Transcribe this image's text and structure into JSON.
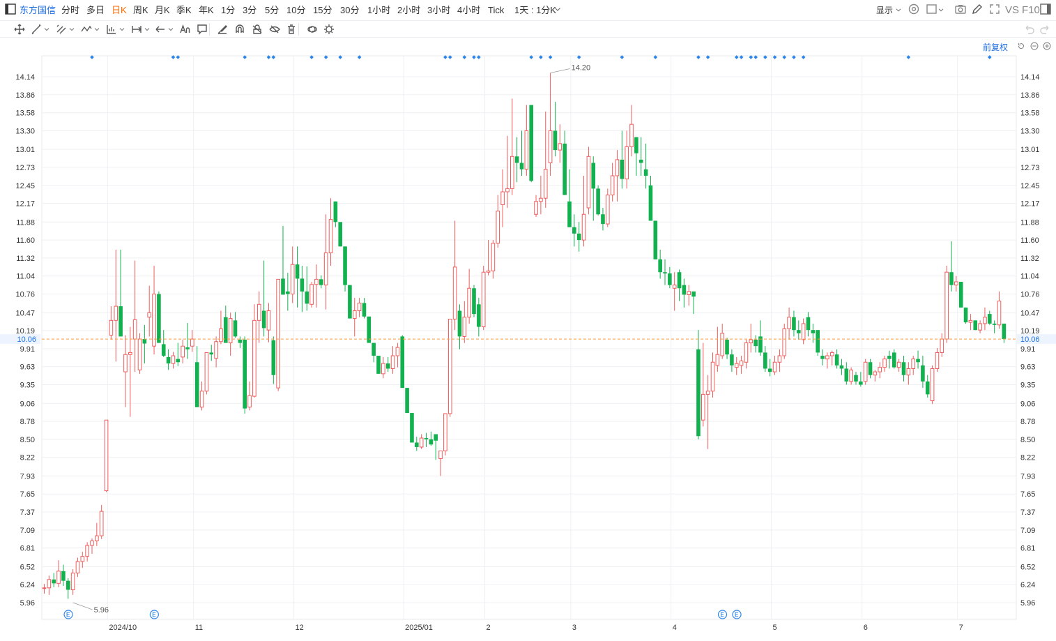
{
  "app": {
    "brand": "东方国信"
  },
  "periods": [
    {
      "label": "分时",
      "active": false
    },
    {
      "label": "多日",
      "active": false
    },
    {
      "label": "日K",
      "active": true
    },
    {
      "label": "周K",
      "active": false
    },
    {
      "label": "月K",
      "active": false
    },
    {
      "label": "季K",
      "active": false
    },
    {
      "label": "年K",
      "active": false
    },
    {
      "label": "1分",
      "active": false
    },
    {
      "label": "3分",
      "active": false
    },
    {
      "label": "5分",
      "active": false
    },
    {
      "label": "10分",
      "active": false
    },
    {
      "label": "15分",
      "active": false
    },
    {
      "label": "30分",
      "active": false
    },
    {
      "label": "1小时",
      "active": false
    },
    {
      "label": "2小时",
      "active": false
    },
    {
      "label": "3小时",
      "active": false
    },
    {
      "label": "4小时",
      "active": false
    },
    {
      "label": "Tick",
      "active": false
    }
  ],
  "custom_period": "1天 : 1分K",
  "right_controls": {
    "display_label": "显示",
    "vs_label": "VS",
    "f10_label": "F10"
  },
  "adjust_label": "前复权",
  "colors": {
    "up": "#f05b5b",
    "down": "#10b14e",
    "accent": "#1f6fe0",
    "active": "#ff6a00",
    "price_line": "#ff9a3c",
    "event_dot": "#2f86e9"
  },
  "draw_tools": [
    "move-icon",
    "line-icon",
    "channel-icon",
    "wave-icon",
    "measure-icon",
    "range-icon",
    "arrow-icon",
    "text-icon",
    "note-icon",
    "brush-icon",
    "magnet-icon",
    "lock-icon",
    "hide-icon",
    "delete-icon",
    "link-icon",
    "settings-icon"
  ],
  "chart_data": {
    "type": "candlestick",
    "y_ticks": [
      "14.14",
      "13.86",
      "13.58",
      "13.30",
      "13.01",
      "12.73",
      "12.45",
      "12.17",
      "11.88",
      "11.60",
      "11.32",
      "11.04",
      "10.76",
      "10.47",
      "10.19",
      "9.91",
      "9.63",
      "9.35",
      "9.06",
      "8.78",
      "8.50",
      "8.22",
      "7.93",
      "7.65",
      "7.37",
      "7.09",
      "6.81",
      "6.52",
      "6.24",
      "5.96"
    ],
    "ylim": [
      5.96,
      14.14
    ],
    "x_labels": [
      {
        "label": "2024/10",
        "index": 14
      },
      {
        "label": "11",
        "index": 32
      },
      {
        "label": "12",
        "index": 53
      },
      {
        "label": "2025/01",
        "index": 76
      },
      {
        "label": "2",
        "index": 93
      },
      {
        "label": "3",
        "index": 111
      },
      {
        "label": "4",
        "index": 132
      },
      {
        "label": "5",
        "index": 153
      },
      {
        "label": "6",
        "index": 172
      },
      {
        "label": "7",
        "index": 192
      }
    ],
    "last_price": "10.06",
    "max_label": {
      "value": "14.20",
      "index": 106
    },
    "min_label": {
      "value": "5.96",
      "index": 6
    },
    "event_markers": [
      3,
      21,
      140,
      143
    ],
    "signal_dots": [
      10,
      27,
      28,
      42,
      47,
      48,
      56,
      59,
      62,
      66,
      84,
      85,
      88,
      90,
      91,
      102,
      104,
      106,
      112,
      121,
      128,
      137,
      139,
      145,
      146,
      148,
      149,
      151,
      153,
      155,
      157,
      159,
      181,
      198
    ],
    "candles": [
      [
        6.18,
        6.25,
        6.1,
        6.19
      ],
      [
        6.19,
        6.38,
        6.08,
        6.32
      ],
      [
        6.32,
        6.42,
        6.2,
        6.26
      ],
      [
        6.26,
        6.62,
        6.2,
        6.45
      ],
      [
        6.45,
        6.55,
        6.22,
        6.3
      ],
      [
        6.3,
        6.34,
        6.02,
        6.16
      ],
      [
        6.16,
        6.48,
        6.08,
        6.42
      ],
      [
        6.42,
        6.66,
        6.36,
        6.6
      ],
      [
        6.6,
        6.75,
        6.5,
        6.68
      ],
      [
        6.68,
        6.9,
        6.6,
        6.85
      ],
      [
        6.85,
        6.96,
        6.72,
        6.92
      ],
      [
        6.92,
        7.2,
        6.84,
        7.0
      ],
      [
        7.0,
        7.48,
        6.95,
        7.38
      ],
      [
        7.7,
        8.8,
        7.68,
        8.8
      ],
      [
        10.12,
        10.57,
        10.05,
        10.35
      ],
      [
        10.35,
        11.45,
        9.71,
        10.57
      ],
      [
        10.57,
        11.45,
        10.2,
        10.1
      ],
      [
        9.55,
        10.12,
        9.0,
        9.82
      ],
      [
        9.82,
        10.25,
        8.85,
        9.85
      ],
      [
        10.06,
        11.28,
        9.55,
        10.36
      ],
      [
        9.58,
        10.15,
        9.52,
        10.06
      ],
      [
        10.06,
        10.28,
        9.68,
        9.99
      ],
      [
        10.4,
        10.89,
        10.1,
        10.47
      ],
      [
        9.95,
        11.2,
        9.82,
        10.76
      ],
      [
        10.76,
        10.8,
        10.0,
        10.0
      ],
      [
        9.98,
        10.2,
        9.78,
        9.8
      ],
      [
        9.78,
        9.9,
        9.58,
        9.68
      ],
      [
        9.68,
        9.86,
        9.6,
        9.8
      ],
      [
        9.75,
        10.0,
        9.64,
        9.7
      ],
      [
        9.78,
        10.05,
        9.68,
        9.95
      ],
      [
        9.93,
        10.31,
        9.75,
        9.9
      ],
      [
        9.95,
        10.2,
        9.86,
        10.06
      ],
      [
        9.7,
        9.95,
        9.0,
        9.0
      ],
      [
        9.0,
        9.4,
        8.95,
        9.25
      ],
      [
        9.25,
        9.82,
        9.2,
        9.85
      ],
      [
        9.85,
        9.97,
        9.72,
        9.82
      ],
      [
        9.76,
        10.1,
        9.62,
        10.02
      ],
      [
        10.02,
        10.5,
        9.98,
        10.22
      ],
      [
        10.4,
        10.58,
        10.3,
        10.0
      ],
      [
        10.0,
        10.47,
        9.8,
        10.38
      ],
      [
        10.35,
        10.48,
        10.08,
        10.1
      ],
      [
        10.05,
        10.1,
        9.92,
        10.0
      ],
      [
        10.05,
        10.1,
        8.9,
        8.98
      ],
      [
        9.0,
        9.4,
        8.95,
        9.18
      ],
      [
        9.17,
        10.6,
        9.15,
        10.35
      ],
      [
        10.35,
        10.8,
        10.0,
        10.6
      ],
      [
        10.5,
        11.28,
        10.1,
        10.23
      ],
      [
        10.2,
        10.62,
        10.01,
        10.5
      ],
      [
        10.04,
        10.1,
        9.36,
        9.5
      ],
      [
        9.3,
        10.25,
        9.25,
        10.99
      ],
      [
        11.0,
        11.82,
        10.75,
        10.75
      ],
      [
        10.8,
        11.09,
        10.5,
        10.76
      ],
      [
        10.76,
        11.5,
        10.62,
        11.22
      ],
      [
        11.22,
        11.5,
        10.55,
        11.0
      ],
      [
        11.0,
        11.2,
        10.48,
        10.8
      ],
      [
        10.8,
        11.19,
        10.5,
        10.61
      ],
      [
        10.6,
        10.95,
        10.55,
        10.91
      ],
      [
        10.91,
        11.22,
        10.55,
        10.99
      ],
      [
        10.99,
        11.05,
        10.85,
        10.9
      ],
      [
        10.9,
        12.0,
        10.52,
        11.4
      ],
      [
        11.4,
        12.25,
        11.2,
        11.92
      ],
      [
        12.2,
        12.2,
        11.8,
        11.88
      ],
      [
        11.88,
        11.88,
        11.5,
        11.5
      ],
      [
        11.5,
        11.5,
        10.8,
        10.9
      ],
      [
        10.9,
        10.9,
        10.38,
        10.38
      ],
      [
        10.38,
        10.7,
        10.1,
        10.5
      ],
      [
        10.5,
        10.7,
        10.4,
        10.62
      ],
      [
        10.62,
        10.7,
        10.38,
        10.41
      ],
      [
        10.41,
        10.41,
        10.0,
        10.0
      ],
      [
        10.0,
        10.0,
        9.7,
        9.8
      ],
      [
        9.8,
        9.8,
        9.52,
        9.52
      ],
      [
        9.52,
        9.78,
        9.45,
        9.68
      ],
      [
        9.68,
        9.78,
        9.55,
        9.6
      ],
      [
        9.6,
        9.95,
        9.52,
        9.8
      ],
      [
        9.8,
        10.0,
        9.62,
        9.93
      ],
      [
        10.1,
        10.12,
        9.3,
        9.3
      ],
      [
        9.3,
        9.3,
        8.91,
        8.91
      ],
      [
        8.91,
        8.91,
        8.45,
        8.45
      ],
      [
        8.45,
        8.54,
        8.32,
        8.38
      ],
      [
        8.38,
        8.58,
        8.35,
        8.52
      ],
      [
        8.52,
        8.6,
        8.38,
        8.5
      ],
      [
        8.5,
        8.62,
        8.4,
        8.42
      ],
      [
        8.58,
        8.58,
        8.18,
        8.48
      ],
      [
        8.2,
        8.28,
        7.93,
        8.32
      ],
      [
        8.32,
        8.9,
        8.25,
        8.9
      ],
      [
        8.9,
        10.37,
        8.85,
        10.37
      ],
      [
        10.37,
        11.9,
        10.2,
        11.18
      ],
      [
        10.5,
        10.6,
        9.9,
        10.1
      ],
      [
        10.1,
        10.65,
        10.0,
        10.4
      ],
      [
        10.4,
        11.15,
        10.3,
        10.85
      ],
      [
        10.85,
        10.9,
        10.4,
        10.45
      ],
      [
        10.6,
        10.7,
        10.1,
        10.25
      ],
      [
        10.25,
        11.2,
        10.2,
        11.1
      ],
      [
        11.1,
        11.6,
        11.05,
        11.12
      ],
      [
        11.12,
        11.6,
        11.0,
        11.55
      ],
      [
        11.55,
        12.3,
        11.48,
        12.05
      ],
      [
        12.15,
        12.7,
        11.8,
        12.35
      ],
      [
        12.35,
        13.22,
        12.1,
        12.4
      ],
      [
        12.4,
        13.8,
        12.3,
        12.9
      ],
      [
        12.9,
        13.2,
        12.5,
        12.8
      ],
      [
        12.8,
        13.3,
        12.6,
        12.7
      ],
      [
        12.7,
        13.7,
        12.6,
        13.3
      ],
      [
        13.7,
        13.7,
        12.5,
        12.52
      ],
      [
        12.0,
        12.3,
        11.96,
        12.2
      ],
      [
        12.2,
        12.6,
        12.0,
        12.25
      ],
      [
        12.25,
        13.6,
        12.1,
        12.7
      ],
      [
        12.8,
        14.2,
        12.6,
        13.3
      ],
      [
        13.3,
        13.75,
        12.9,
        13.0
      ],
      [
        13.0,
        13.4,
        12.8,
        13.1
      ],
      [
        13.1,
        13.3,
        12.3,
        12.3
      ],
      [
        12.2,
        12.7,
        11.8,
        11.8
      ],
      [
        11.8,
        12.0,
        11.5,
        11.7
      ],
      [
        11.7,
        11.88,
        11.42,
        11.6
      ],
      [
        11.6,
        12.6,
        11.5,
        12.0
      ],
      [
        12.1,
        13.05,
        12.0,
        12.9
      ],
      [
        12.8,
        12.9,
        11.9,
        12.4
      ],
      [
        12.4,
        12.45,
        11.98,
        12.0
      ],
      [
        12.0,
        12.1,
        11.75,
        11.85
      ],
      [
        11.85,
        12.4,
        11.8,
        12.3
      ],
      [
        12.3,
        12.8,
        12.2,
        12.6
      ],
      [
        12.6,
        13.0,
        12.2,
        12.85
      ],
      [
        12.85,
        13.3,
        12.4,
        12.55
      ],
      [
        12.55,
        13.3,
        12.4,
        13.05
      ],
      [
        13.05,
        13.7,
        12.9,
        13.4
      ],
      [
        13.2,
        13.2,
        12.6,
        12.95
      ],
      [
        12.85,
        13.2,
        12.6,
        12.8
      ],
      [
        12.7,
        13.1,
        12.4,
        12.6
      ],
      [
        12.45,
        12.6,
        11.9,
        11.9
      ],
      [
        11.9,
        11.9,
        11.3,
        11.3
      ],
      [
        11.3,
        11.45,
        11.0,
        11.1
      ],
      [
        11.1,
        11.3,
        10.9,
        11.08
      ],
      [
        11.08,
        11.18,
        10.85,
        10.9
      ],
      [
        10.85,
        11.1,
        10.5,
        10.9
      ],
      [
        11.1,
        11.14,
        10.65,
        10.85
      ],
      [
        10.9,
        11.0,
        10.55,
        10.75
      ],
      [
        10.75,
        10.9,
        10.58,
        10.8
      ],
      [
        10.8,
        10.8,
        10.45,
        10.72
      ],
      [
        9.9,
        10.2,
        8.5,
        8.55
      ],
      [
        8.8,
        10.0,
        8.7,
        9.2
      ],
      [
        9.2,
        9.5,
        8.35,
        9.25
      ],
      [
        9.25,
        9.85,
        9.15,
        9.7
      ],
      [
        9.65,
        10.25,
        9.55,
        9.82
      ],
      [
        9.8,
        10.3,
        9.75,
        10.15
      ],
      [
        10.05,
        10.08,
        9.75,
        9.82
      ],
      [
        9.82,
        9.9,
        9.55,
        9.65
      ],
      [
        9.62,
        9.78,
        9.5,
        9.68
      ],
      [
        9.65,
        9.8,
        9.52,
        9.72
      ],
      [
        9.7,
        10.05,
        9.6,
        10.0
      ],
      [
        10.0,
        10.3,
        9.85,
        10.05
      ],
      [
        10.05,
        10.12,
        9.85,
        9.95
      ],
      [
        10.1,
        10.35,
        9.8,
        9.85
      ],
      [
        9.85,
        9.95,
        9.55,
        9.6
      ],
      [
        9.6,
        9.75,
        9.48,
        9.55
      ],
      [
        9.55,
        9.8,
        9.5,
        9.7
      ],
      [
        9.7,
        9.9,
        9.55,
        9.8
      ],
      [
        9.8,
        10.3,
        9.75,
        10.22
      ],
      [
        10.22,
        10.55,
        10.05,
        10.4
      ],
      [
        10.4,
        10.5,
        10.1,
        10.2
      ],
      [
        10.2,
        10.35,
        10.05,
        10.15
      ],
      [
        10.05,
        10.38,
        9.98,
        10.3
      ],
      [
        10.4,
        10.48,
        10.1,
        10.2
      ],
      [
        10.2,
        10.3,
        10.0,
        10.15
      ],
      [
        10.2,
        10.2,
        9.8,
        9.85
      ],
      [
        9.8,
        9.9,
        9.65,
        9.75
      ],
      [
        9.75,
        9.85,
        9.6,
        9.8
      ],
      [
        9.8,
        9.88,
        9.65,
        9.85
      ],
      [
        9.82,
        9.9,
        9.6,
        9.65
      ],
      [
        9.65,
        9.75,
        9.5,
        9.6
      ],
      [
        9.6,
        9.7,
        9.35,
        9.4
      ],
      [
        9.4,
        9.62,
        9.35,
        9.58
      ],
      [
        9.5,
        9.55,
        9.35,
        9.4
      ],
      [
        9.4,
        9.55,
        9.32,
        9.35
      ],
      [
        9.4,
        9.75,
        9.35,
        9.7
      ],
      [
        9.7,
        9.75,
        9.45,
        9.5
      ],
      [
        9.5,
        9.58,
        9.4,
        9.55
      ],
      [
        9.55,
        9.7,
        9.45,
        9.62
      ],
      [
        9.62,
        9.8,
        9.55,
        9.75
      ],
      [
        9.8,
        9.88,
        9.6,
        9.75
      ],
      [
        9.85,
        9.9,
        9.6,
        9.62
      ],
      [
        9.62,
        9.75,
        9.55,
        9.7
      ],
      [
        9.7,
        9.8,
        9.4,
        9.5
      ],
      [
        9.5,
        9.7,
        9.35,
        9.6
      ],
      [
        9.6,
        9.8,
        9.5,
        9.75
      ],
      [
        9.75,
        9.88,
        9.6,
        9.7
      ],
      [
        9.65,
        9.8,
        9.3,
        9.4
      ],
      [
        9.4,
        9.5,
        9.15,
        9.2
      ],
      [
        9.1,
        9.65,
        9.05,
        9.6
      ],
      [
        9.6,
        9.92,
        9.55,
        9.85
      ],
      [
        9.85,
        10.15,
        9.78,
        10.06
      ],
      [
        10.06,
        11.2,
        10.0,
        11.1
      ],
      [
        11.1,
        11.58,
        10.8,
        10.9
      ],
      [
        10.9,
        11.04,
        10.8,
        10.95
      ],
      [
        10.95,
        10.95,
        10.55,
        10.55
      ],
      [
        10.55,
        10.55,
        10.3,
        10.32
      ],
      [
        10.32,
        10.45,
        10.2,
        10.35
      ],
      [
        10.35,
        10.35,
        10.2,
        10.2
      ],
      [
        10.2,
        10.35,
        10.15,
        10.3
      ],
      [
        10.3,
        10.55,
        10.2,
        10.4
      ],
      [
        10.45,
        10.5,
        10.28,
        10.3
      ],
      [
        10.3,
        10.35,
        10.15,
        10.28
      ],
      [
        10.28,
        10.8,
        10.22,
        10.65
      ],
      [
        10.3,
        10.3,
        10.0,
        10.06
      ]
    ]
  }
}
